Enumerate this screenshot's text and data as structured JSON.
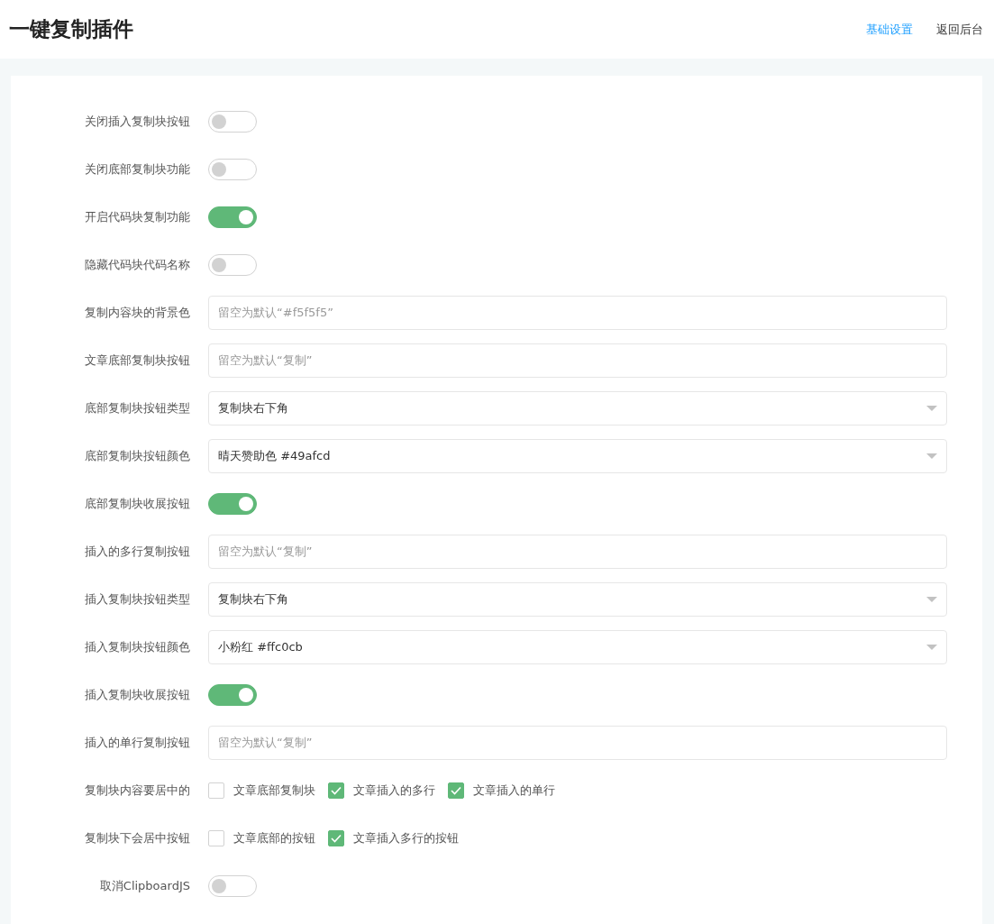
{
  "header": {
    "title": "一键复制插件",
    "links": [
      {
        "label": "基础设置",
        "selected": true
      },
      {
        "label": "返回后台",
        "selected": false
      }
    ]
  },
  "settings": [
    {
      "kind": "toggle",
      "label": "关闭插入复制块按钮",
      "on": false
    },
    {
      "kind": "toggle",
      "label": "关闭底部复制块功能",
      "on": false
    },
    {
      "kind": "toggle",
      "label": "开启代码块复制功能",
      "on": true
    },
    {
      "kind": "toggle",
      "label": "隐藏代码块代码名称",
      "on": false
    },
    {
      "kind": "input",
      "label": "复制内容块的背景色",
      "placeholder": "留空为默认“#f5f5f5”"
    },
    {
      "kind": "input",
      "label": "文章底部复制块按钮",
      "placeholder": "留空为默认“复制”"
    },
    {
      "kind": "select",
      "label": "底部复制块按钮类型",
      "value": "复制块右下角"
    },
    {
      "kind": "select",
      "label": "底部复制块按钮颜色",
      "value": "晴天赞助色 #49afcd"
    },
    {
      "kind": "toggle",
      "label": "底部复制块收展按钮",
      "on": true
    },
    {
      "kind": "input",
      "label": "插入的多行复制按钮",
      "placeholder": "留空为默认“复制”"
    },
    {
      "kind": "select",
      "label": "插入复制块按钮类型",
      "value": "复制块右下角"
    },
    {
      "kind": "select",
      "label": "插入复制块按钮颜色",
      "value": "小粉红 #ffc0cb"
    },
    {
      "kind": "toggle",
      "label": "插入复制块收展按钮",
      "on": true
    },
    {
      "kind": "input",
      "label": "插入的单行复制按钮",
      "placeholder": "留空为默认“复制”"
    },
    {
      "kind": "checkboxes",
      "label": "复制块内容要居中的",
      "options": [
        {
          "label": "文章底部复制块",
          "checked": false
        },
        {
          "label": "文章插入的多行",
          "checked": true
        },
        {
          "label": "文章插入的单行",
          "checked": true
        }
      ]
    },
    {
      "kind": "checkboxes",
      "label": "复制块下会居中按钮",
      "options": [
        {
          "label": "文章底部的按钮",
          "checked": false
        },
        {
          "label": "文章插入多行的按钮",
          "checked": true
        }
      ]
    },
    {
      "kind": "toggle",
      "label": "取消ClipboardJS",
      "on": false
    }
  ]
}
